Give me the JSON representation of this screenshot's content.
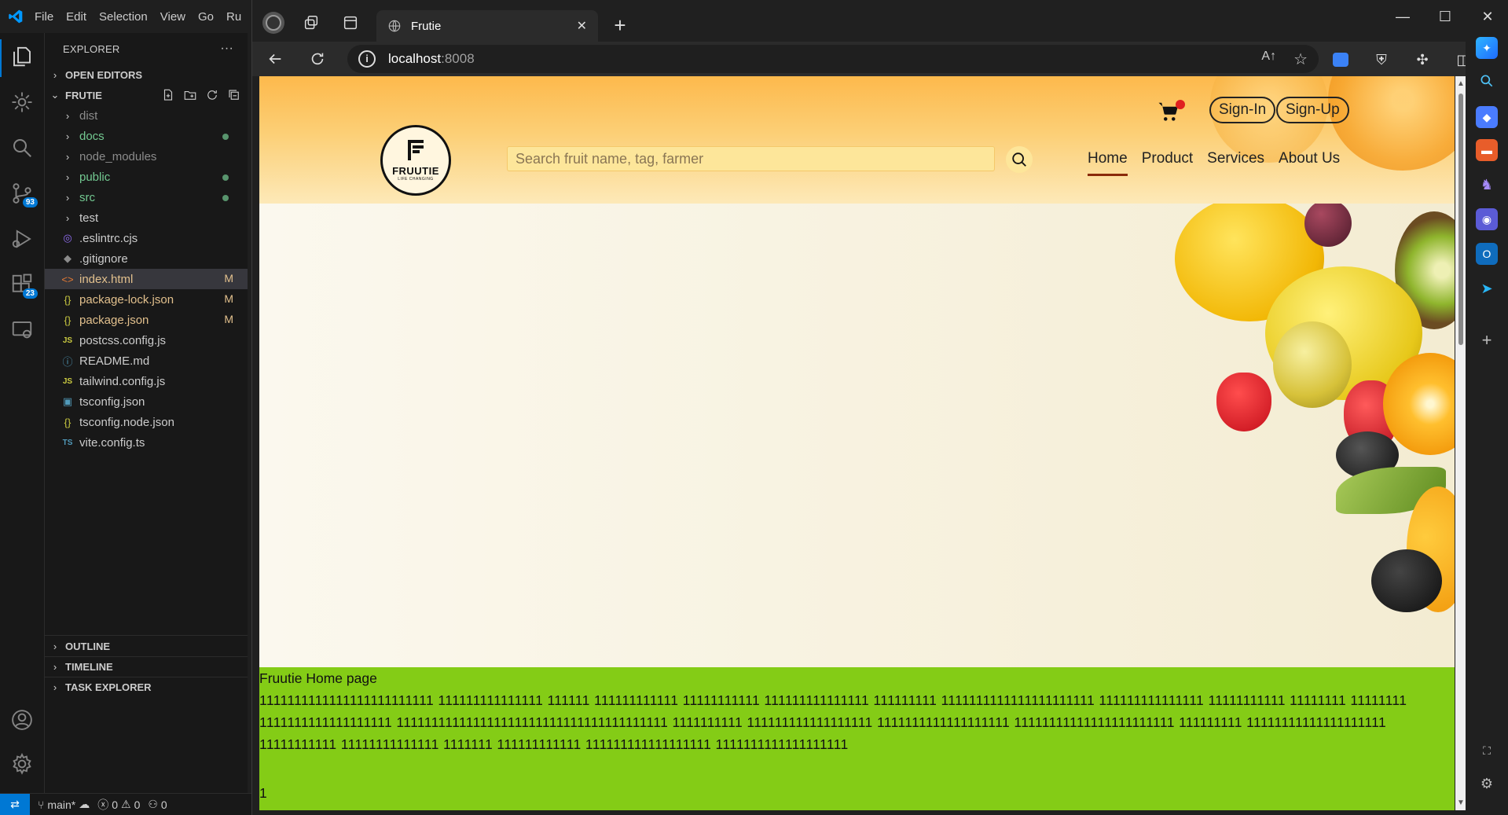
{
  "vscode": {
    "menu": [
      "File",
      "Edit",
      "Selection",
      "View",
      "Go",
      "Ru"
    ],
    "explorer_title": "EXPLORER",
    "explorer_more": "···",
    "open_editors": "OPEN EDITORS",
    "project": "FRUTIE",
    "badges": {
      "source_control": "93",
      "extensions": "23"
    },
    "tree": [
      {
        "icon": "chevron-right",
        "glyph": "›",
        "label": "dist",
        "color": "gray"
      },
      {
        "icon": "chevron-right",
        "glyph": "›",
        "label": "docs",
        "color": "green",
        "dot": true
      },
      {
        "icon": "chevron-right",
        "glyph": "›",
        "label": "node_modules",
        "color": "gray"
      },
      {
        "icon": "chevron-right",
        "glyph": "›",
        "label": "public",
        "color": "green",
        "dot": true
      },
      {
        "icon": "chevron-right",
        "glyph": "›",
        "label": "src",
        "color": "green",
        "dot": true
      },
      {
        "icon": "chevron-right",
        "glyph": "›",
        "label": "test",
        "color": "white"
      },
      {
        "icon": "eslint-file-icon",
        "glyph": "◎",
        "label": ".eslintrc.cjs",
        "color": "white"
      },
      {
        "icon": "git-file-icon",
        "glyph": "◆",
        "label": ".gitignore",
        "color": "white"
      },
      {
        "icon": "html-file-icon",
        "glyph": "<>",
        "label": "index.html",
        "color": "yellow",
        "mod": "M",
        "selected": true
      },
      {
        "icon": "json-file-icon",
        "glyph": "{}",
        "label": "package-lock.json",
        "color": "yellow",
        "mod": "M"
      },
      {
        "icon": "json-file-icon",
        "glyph": "{}",
        "label": "package.json",
        "color": "yellow",
        "mod": "M"
      },
      {
        "icon": "js-file-icon",
        "glyph": "JS",
        "label": "postcss.config.js",
        "color": "white"
      },
      {
        "icon": "info-file-icon",
        "glyph": "ⓘ",
        "label": "README.md",
        "color": "white"
      },
      {
        "icon": "js-file-icon",
        "glyph": "JS",
        "label": "tailwind.config.js",
        "color": "white"
      },
      {
        "icon": "ts-config-file-icon",
        "glyph": "▣",
        "label": "tsconfig.json",
        "color": "white"
      },
      {
        "icon": "json-file-icon",
        "glyph": "{}",
        "label": "tsconfig.node.json",
        "color": "white"
      },
      {
        "icon": "ts-file-icon",
        "glyph": "TS",
        "label": "vite.config.ts",
        "color": "white"
      }
    ],
    "outline": "OUTLINE",
    "timeline": "TIMELINE",
    "task_explorer": "TASK EXPLORER",
    "status": {
      "branch": "main*",
      "errors": "0",
      "warnings": "0",
      "ports": "0"
    }
  },
  "browser": {
    "tab_title": "Frutie",
    "url_host": "localhost",
    "url_port": ":8008"
  },
  "site": {
    "logo_name": "FRUUTIE",
    "logo_tag": "LIFE CHANGING",
    "search_placeholder": "Search fruit name, tag, farmer",
    "nav": [
      "Home",
      "Product",
      "Services",
      "About Us"
    ],
    "sign_in": "Sign-In",
    "sign_up": "Sign-Up",
    "green_title": "Fruutie Home page",
    "green_body": "1111111111111111111111111 111111111111111 111111 111111111111 11111111111 111111111111111 111111111 1111111111111111111111 111111111111111 11111111111 11111111 11111111 1111111111111111111 111111111111111111111111111111111111111 1111111111 111111111111111111 1111111111111111111 11111111111111111111111 111111111 11111111111111111111 11111111111 11111111111111 1111111 111111111111 111111111111111111 1111111111111111111",
    "green_footer": "1",
    "colors": {
      "green": "#84cc16",
      "header": "#fdb94c",
      "search": "#fde69a"
    }
  }
}
